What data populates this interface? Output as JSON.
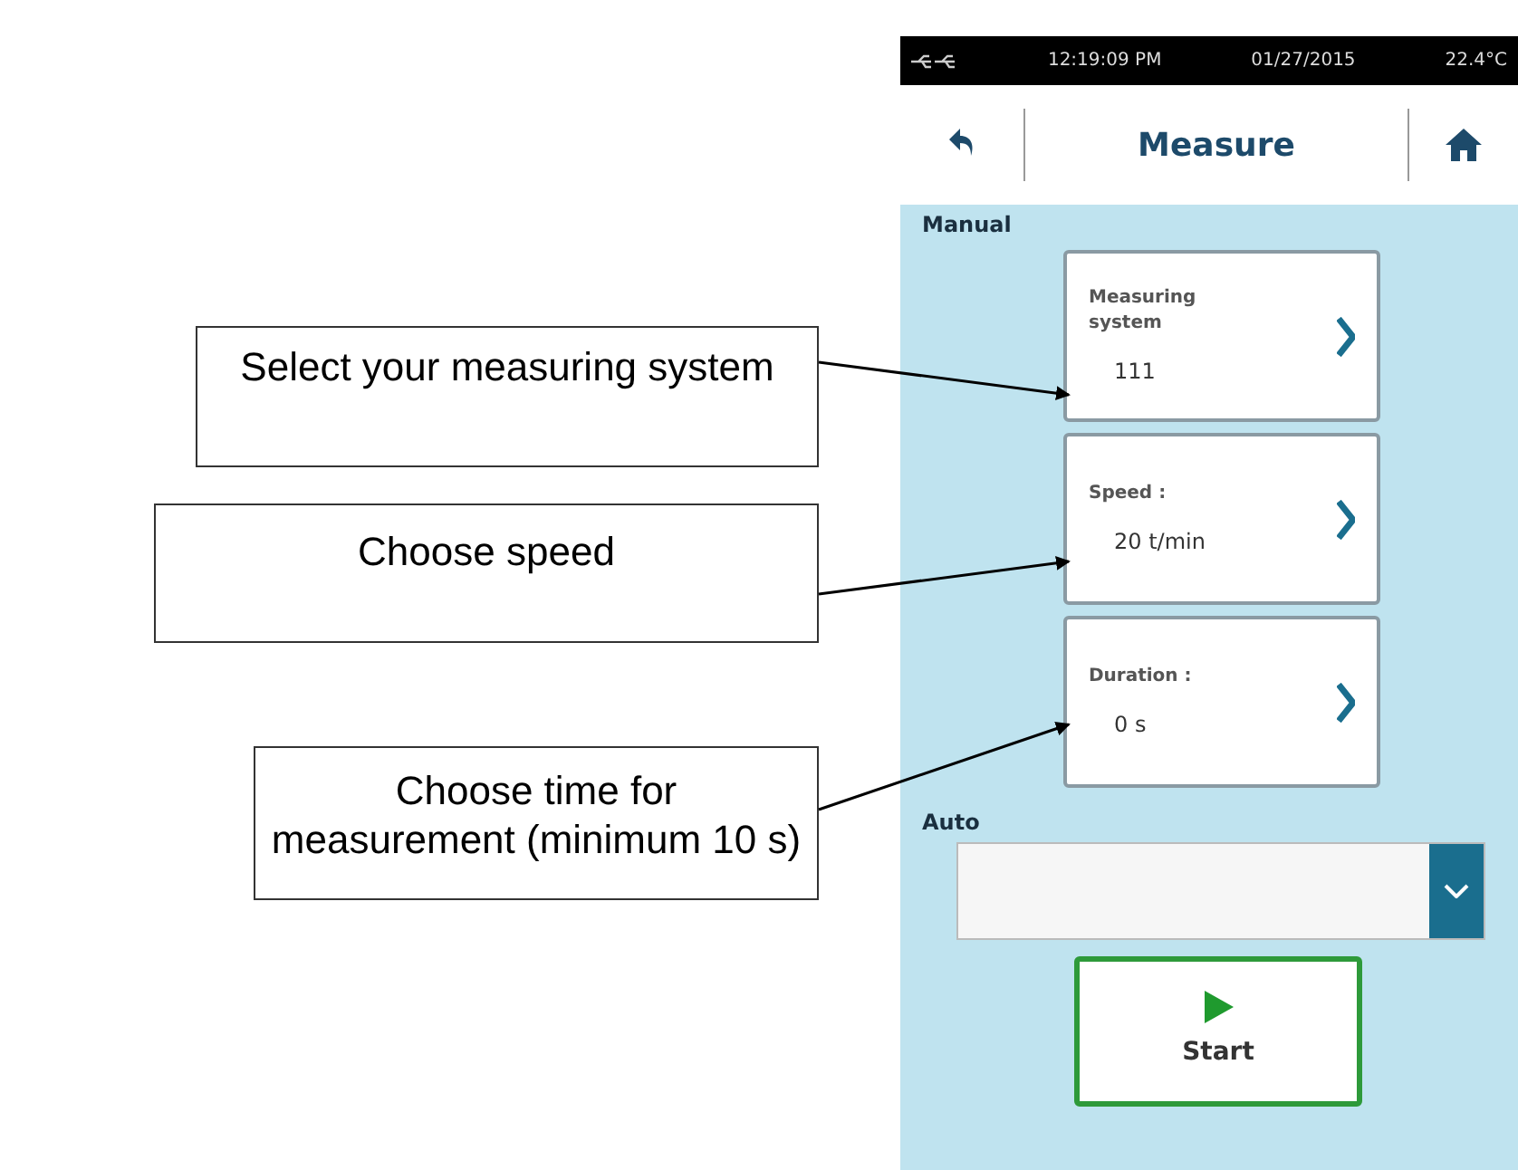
{
  "status_bar": {
    "time": "12:19:09 PM",
    "date": "01/27/2015",
    "temperature": "22.4°C"
  },
  "header": {
    "title": "Measure"
  },
  "manual": {
    "label": "Manual",
    "items": [
      {
        "label": "Measuring system",
        "value": "111"
      },
      {
        "label": "Speed :",
        "value": "20 t/min"
      },
      {
        "label": "Duration :",
        "value": "0 s"
      }
    ]
  },
  "auto": {
    "label": "Auto"
  },
  "start_button": {
    "label": "Start"
  },
  "callouts": [
    {
      "text": "Select your measuring system"
    },
    {
      "text": "Choose speed"
    },
    {
      "text": "Choose time for measurement (minimum 10 s)"
    }
  ]
}
